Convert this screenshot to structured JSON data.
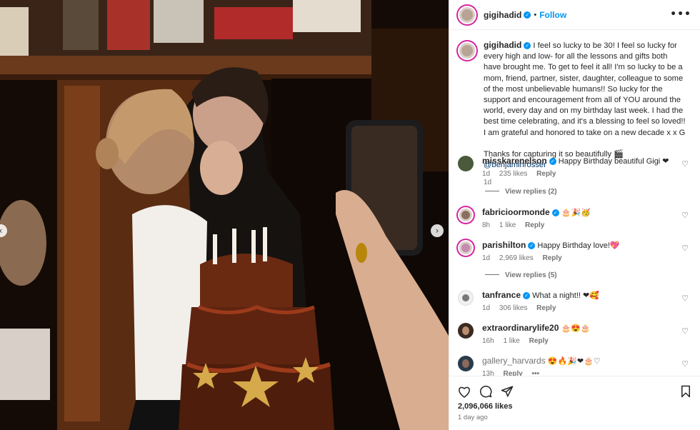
{
  "post": {
    "author": "gigihadid",
    "follow_label": "Follow",
    "dot": "•",
    "more_label": "•••",
    "caption_lead": " I feel so lucky to be 30! I feel so lucky for every high and low- for all the lessons and gifts both have brought me. To get to feel it all! I'm so lucky to be a mom, friend, partner, sister, daughter, colleague to some of the most unbelievable humans!! So lucky for the support and encouragement from all of YOU around the world, every day and on my birthday last week. I had the best time celebrating, and it's a blessing to feel so loved!! I am grateful and honored to take on a new decade x x G",
    "caption_credit": "Thanks for capturing it so beautifully 🎬 ",
    "caption_mention": "@benjaminrosser",
    "caption_time": "1d",
    "likes": "2,096,066 likes",
    "posted_ago": "1 day ago"
  },
  "comments": [
    {
      "user": "misskarenelson",
      "verified": true,
      "text": "Happy Birthday beautiful Gigi ❤",
      "time": "1d",
      "likes": "235 likes",
      "reply": "Reply",
      "view_replies": "View replies (2)"
    },
    {
      "user": "fabricioormonde",
      "verified": true,
      "text": "🎂🎉🥳",
      "time": "8h",
      "likes": "1 like",
      "reply": "Reply"
    },
    {
      "user": "parishilton",
      "verified": true,
      "text": "Happy Birthday love!💖",
      "time": "1d",
      "likes": "2,969 likes",
      "reply": "Reply",
      "view_replies": "View replies (5)"
    },
    {
      "user": "tanfrance",
      "verified": true,
      "text": "What a night!! ❤🥰",
      "time": "1d",
      "likes": "306 likes",
      "reply": "Reply"
    },
    {
      "user": "extraordinarylife20",
      "verified": false,
      "text": "🎂😍🎂",
      "time": "16h",
      "likes": "1 like",
      "reply": "Reply"
    },
    {
      "user": "gallery_harvards",
      "verified": false,
      "text": "😍🔥🎉❤🎂♡",
      "time": "13h",
      "likes": "",
      "reply": "Reply",
      "more": "•••"
    }
  ],
  "icons": {
    "like": "heart-icon",
    "comment": "comment-icon",
    "share": "share-icon",
    "save": "bookmark-icon",
    "prev": "chevron-left-icon",
    "next": "chevron-right-icon"
  },
  "colors": {
    "accent": "#0095f6",
    "link": "#00376b",
    "muted": "#737373",
    "heart": "#ed1c24"
  }
}
